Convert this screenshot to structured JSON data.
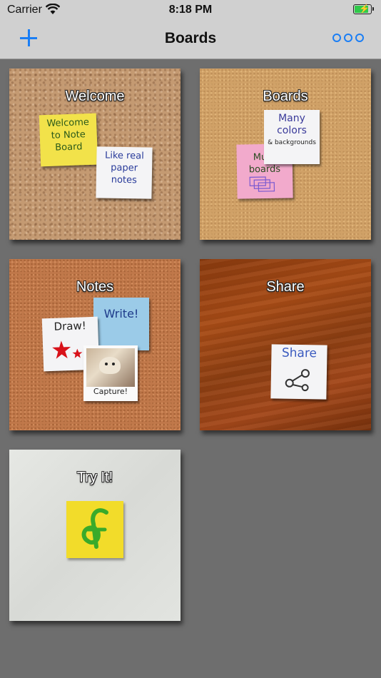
{
  "status_bar": {
    "carrier": "Carrier",
    "time": "8:18 PM",
    "battery_level": 0.9
  },
  "nav": {
    "title": "Boards",
    "add_icon": "plus-icon",
    "more_icon": "ellipsis-circles-icon"
  },
  "tiles": [
    {
      "label": "Welcome",
      "notes": [
        "Welcome to Note Board",
        "Like real paper notes"
      ]
    },
    {
      "label": "Boards",
      "notes": [
        "Multi boards",
        "Many colors",
        "& backgrounds"
      ]
    },
    {
      "label": "Notes",
      "notes": [
        "Write!",
        "Draw!",
        "Capture!"
      ]
    },
    {
      "label": "Share",
      "notes": [
        "Share"
      ]
    },
    {
      "label": "Try It!",
      "notes": []
    }
  ],
  "colors": {
    "accent": "#1a7ef5",
    "background": "#6e6e6e",
    "bar": "#d0d0d0"
  }
}
